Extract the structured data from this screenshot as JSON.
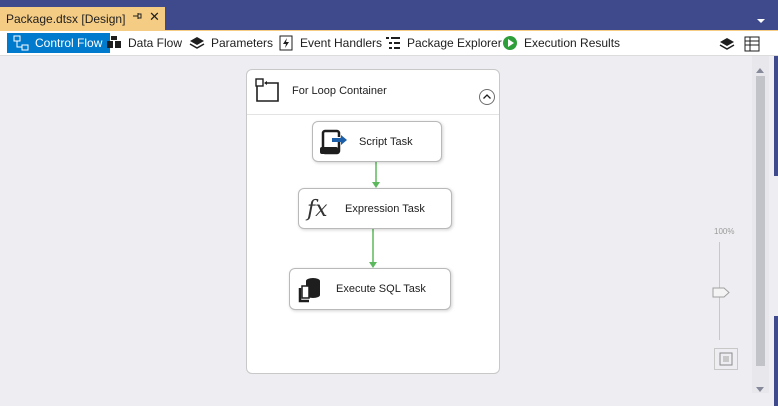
{
  "document_tab": {
    "title": "Package.dtsx [Design]",
    "pin_icon": "pin-icon",
    "close_label": "✕"
  },
  "toolbar": {
    "items": [
      {
        "label": "Control Flow",
        "icon": "control-flow-icon",
        "active": true
      },
      {
        "label": "Data Flow",
        "icon": "data-flow-icon",
        "active": false
      },
      {
        "label": "Parameters",
        "icon": "parameters-icon",
        "active": false
      },
      {
        "label": "Event Handlers",
        "icon": "event-handlers-icon",
        "active": false
      },
      {
        "label": "Package Explorer",
        "icon": "package-explorer-icon",
        "active": false
      },
      {
        "label": "Execution Results",
        "icon": "execution-results-icon",
        "active": false
      }
    ]
  },
  "container": {
    "title": "For Loop Container",
    "icon": "for-loop-container-icon",
    "collapse_icon": "chevron-up-icon"
  },
  "tasks": {
    "script": {
      "label": "Script Task",
      "icon": "script-task-icon"
    },
    "expression": {
      "label": "Expression Task",
      "icon": "expression-task-icon",
      "glyph": "fx"
    },
    "sql": {
      "label": "Execute SQL Task",
      "icon": "execute-sql-icon"
    }
  },
  "zoom": {
    "label": "100%",
    "level_percent": 100
  },
  "colors": {
    "tab_strip": "#3f4a8c",
    "active_tab": "#f5cc84",
    "active_toolbar": "#007acc",
    "connector": "#5cb85c",
    "canvas": "#eeeef2"
  }
}
